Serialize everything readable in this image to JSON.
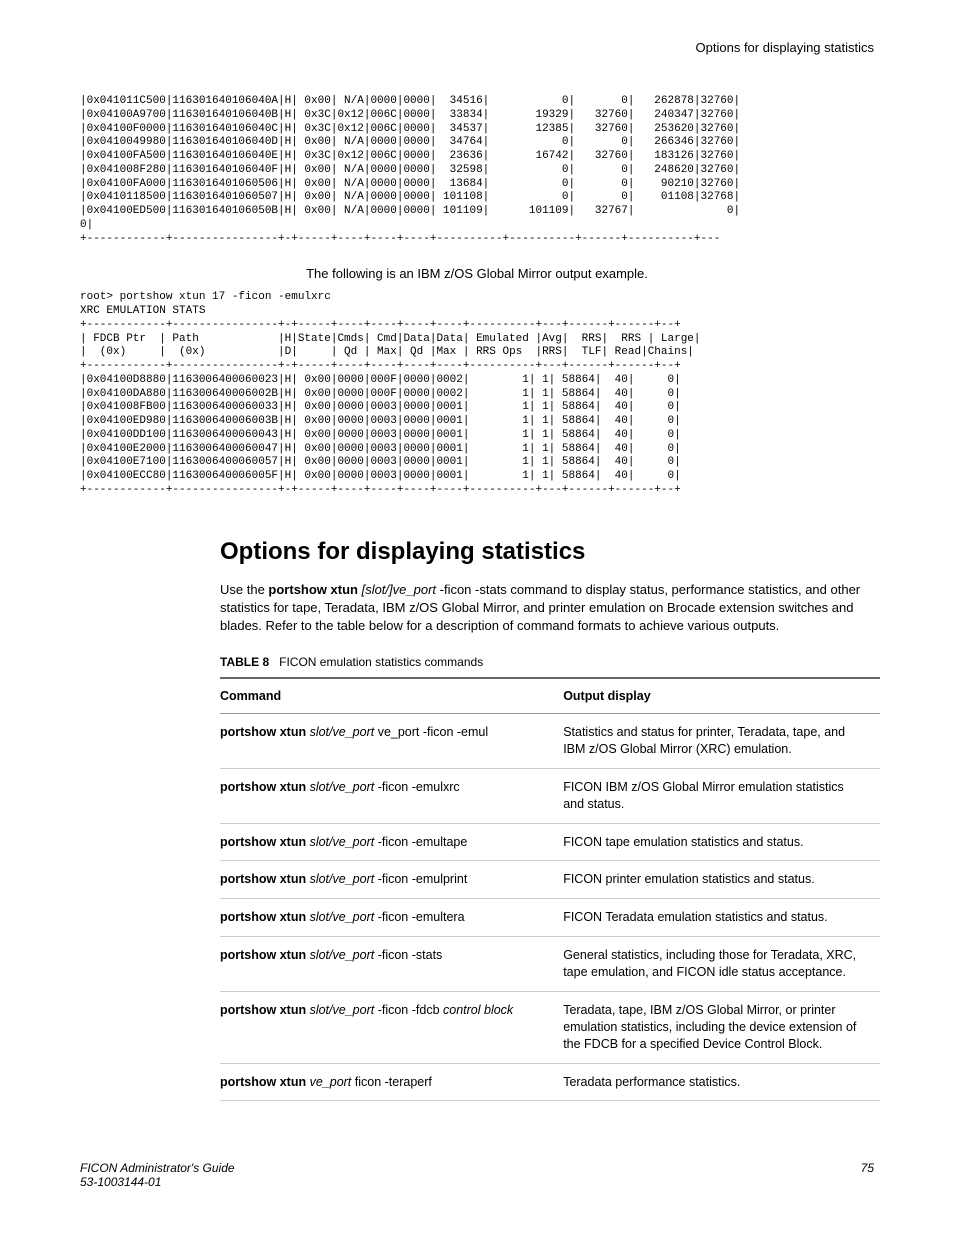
{
  "header": {
    "title": "Options for displaying statistics"
  },
  "codeblock1": "|0x041011C500|116301640106040A|H| 0x00| N/A|0000|0000|  34516|           0|       0|   262878|32760|\n|0x04100A9700|116301640106040B|H| 0x3C|0x12|006C|0000|  33834|       19329|   32760|   240347|32760|\n|0x04100F0000|116301640106040C|H| 0x3C|0x12|006C|0000|  34537|       12385|   32760|   253620|32760|\n|0x0410049980|116301640106040D|H| 0x00| N/A|0000|0000|  34764|           0|       0|   266346|32760|\n|0x04100FA500|116301640106040E|H| 0x3C|0x12|006C|0000|  23636|       16742|   32760|   183126|32760|\n|0x041008F280|116301640106040F|H| 0x00| N/A|0000|0000|  32598|           0|       0|   248620|32760|\n|0x04100FA000|1163016401060506|H| 0x00| N/A|0000|0000|  13684|           0|       0|    90210|32760|\n|0x0410118500|1163016401060507|H| 0x00| N/A|0000|0000| 101108|           0|       0|    01108|32768|\n|0x04100ED500|116301640106050B|H| 0x00| N/A|0000|0000| 101109|      101109|   32767|              0|\n0|\n+------------+----------------+-+-----+----+----+----+----------+----------+------+----------+---",
  "caption1": "The following is an IBM z/OS Global Mirror output example.",
  "codeblock2": "root> portshow xtun 17 -ficon -emulxrc\nXRC EMULATION STATS\n+------------+----------------+-+-----+----+----+----+----+----------+---+------+------+--+\n| FDCB Ptr  | Path            |H|State|Cmds| Cmd|Data|Data| Emulated |Avg|  RRS|  RRS | Large|\n|  (0x)     |  (0x)           |D|     | Qd | Max| Qd |Max | RRS Ops  |RRS|  TLF| Read|Chains|\n+------------+----------------+-+-----+----+----+----+----+----------+---+------+------+--+\n|0x04100D8880|1163006400060023|H| 0x00|0000|000F|0000|0002|        1| 1| 58864|  40|     0|\n|0x04100DA880|116300640006002B|H| 0x00|0000|000F|0000|0002|        1| 1| 58864|  40|     0|\n|0x041008FB00|1163006400060033|H| 0x00|0000|0003|0000|0001|        1| 1| 58864|  40|     0|\n|0x04100ED980|116300640006003B|H| 0x00|0000|0003|0000|0001|        1| 1| 58864|  40|     0|\n|0x04100DD100|1163006400060043|H| 0x00|0000|0003|0000|0001|        1| 1| 58864|  40|     0|\n|0x04100E2000|1163006400060047|H| 0x00|0000|0003|0000|0001|        1| 1| 58864|  40|     0|\n|0x04100E7100|1163006400060057|H| 0x00|0000|0003|0000|0001|        1| 1| 58864|  40|     0|\n|0x04100ECC80|116300640006005F|H| 0x00|0000|0003|0000|0001|        1| 1| 58864|  40|     0|\n+------------+----------------+-+-----+----+----+----+----+----------+---+------+------+--+",
  "h1": "Options for displaying statistics",
  "body": {
    "pre": "Use the ",
    "bold": "portshow xtun",
    "ital": " [slot/]ve_port ",
    "post": "-ficon -stats command to display status, performance statistics, and other statistics for tape, Teradata, IBM z/OS Global Mirror, and printer emulation on Brocade extension switches and blades. Refer to the table below for a description of command formats to achieve various outputs."
  },
  "table": {
    "caption_label": "TABLE 8",
    "caption_text": "FICON emulation statistics commands",
    "headers": {
      "c1": "Command",
      "c2": "Output display"
    },
    "rows": [
      {
        "b": "portshow xtun",
        "i": " slot/ve_port ",
        "t": "ve_port -ficon -emul",
        "out": "Statistics and status for printer, Teradata, tape, and IBM z/OS Global Mirror (XRC) emulation."
      },
      {
        "b": "portshow xtun",
        "i": " slot/ve_port ",
        "t": "-ficon -emulxrc",
        "out": "FICON IBM z/OS Global Mirror emulation statistics and status."
      },
      {
        "b": "portshow xtun",
        "i": " slot/ve_port ",
        "t": "-ficon -emultape",
        "out": "FICON tape emulation statistics and status."
      },
      {
        "b": "portshow xtun",
        "i": " slot/ve_port ",
        "t": "-ficon -emulprint",
        "out": "FICON printer emulation statistics and status."
      },
      {
        "b": "portshow xtun",
        "i": " slot/ve_port ",
        "t": "-ficon -emultera",
        "out": "FICON Teradata emulation statistics and status."
      },
      {
        "b": "portshow xtun",
        "i": " slot/ve_port ",
        "t": "-ficon -stats",
        "out": "General statistics, including those for Teradata, XRC, tape emulation, and FICON idle status acceptance."
      },
      {
        "b": "portshow xtun",
        "i": " slot/ve_port ",
        "t": "-ficon -fdcb ",
        "i2": "control block",
        "out": "Teradata, tape, IBM z/OS Global Mirror, or printer emulation statistics, including the device extension of the FDCB for a specified Device Control Block."
      },
      {
        "b": "portshow xtun",
        "i": " ve_port ",
        "t": "ficon -teraperf",
        "out": "Teradata performance statistics."
      }
    ]
  },
  "footer": {
    "left1": "FICON Administrator's Guide",
    "left2": "53-1003144-01",
    "right": "75"
  }
}
